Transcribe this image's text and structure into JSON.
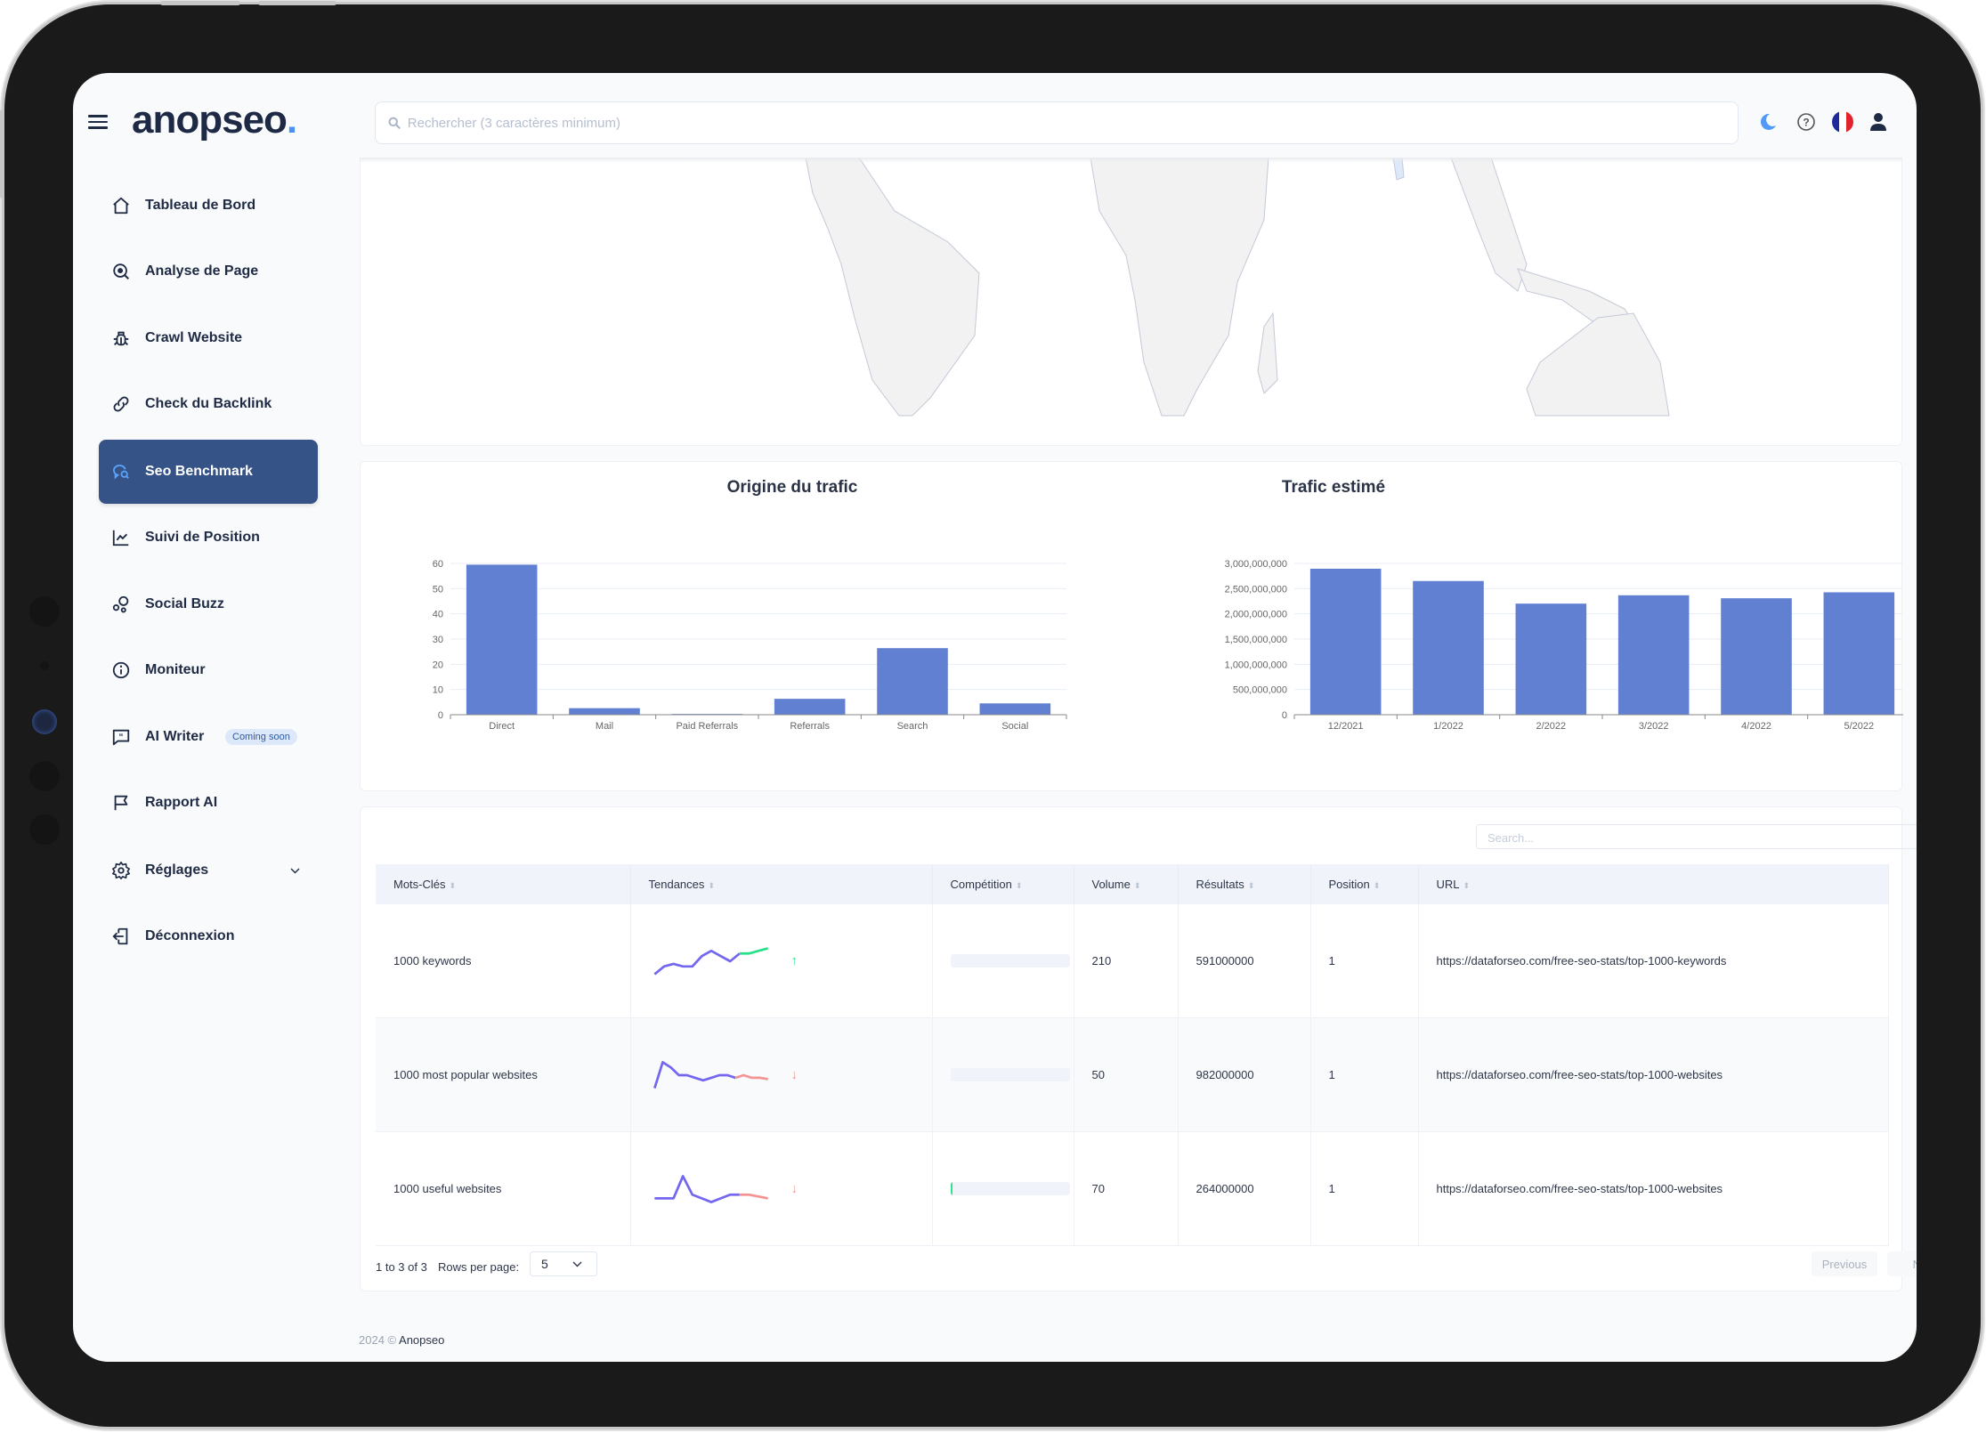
{
  "header": {
    "logo_text": "anopseo",
    "search_placeholder": "Rechercher (3 caractères minimum)",
    "icons": [
      "menu-icon",
      "moon-icon",
      "help-icon",
      "flag-fr-icon",
      "user-icon"
    ]
  },
  "sidebar": {
    "items": [
      {
        "label": "Tableau de Bord",
        "icon": "home-icon"
      },
      {
        "label": "Analyse de Page",
        "icon": "page-analysis-icon"
      },
      {
        "label": "Crawl Website",
        "icon": "bug-icon"
      },
      {
        "label": "Check du Backlink",
        "icon": "link-icon"
      },
      {
        "label": "Seo Benchmark",
        "icon": "benchmark-icon",
        "active": true
      },
      {
        "label": "Suivi de Position",
        "icon": "chart-line-icon"
      },
      {
        "label": "Social Buzz",
        "icon": "bubbles-icon"
      },
      {
        "label": "Moniteur",
        "icon": "info-icon"
      },
      {
        "label": "AI Writer",
        "icon": "quote-icon",
        "badge": "Coming soon"
      },
      {
        "label": "Rapport AI",
        "icon": "flag-icon"
      },
      {
        "label": "Réglages",
        "icon": "gear-icon",
        "has_submenu": true
      },
      {
        "label": "Déconnexion",
        "icon": "logout-icon"
      }
    ]
  },
  "colors": {
    "accent": "#365388",
    "bar": "#6280d2",
    "spark": "#7367f0",
    "up": "#28e08a",
    "down": "#f59393"
  },
  "chart_data": [
    {
      "type": "bar",
      "title": "Origine du trafic",
      "categories": [
        "Direct",
        "Mail",
        "Paid Referrals",
        "Referrals",
        "Search",
        "Social"
      ],
      "values": [
        59.5,
        2.6,
        0.3,
        6.3,
        26.4,
        4.5
      ],
      "yticks": [
        "0",
        "10",
        "20",
        "30",
        "40",
        "50",
        "60"
      ],
      "ylim": [
        0,
        60
      ],
      "xlabel": "",
      "ylabel": "",
      "grid": true,
      "legend": "none"
    },
    {
      "type": "bar",
      "title": "Trafic estimé",
      "categories": [
        "12/2021",
        "1/2022",
        "2/2022",
        "3/2022",
        "4/2022",
        "5/2022"
      ],
      "values": [
        2894000000,
        2651000000,
        2203000000,
        2368000000,
        2309000000,
        2427000000
      ],
      "yticks": [
        "0",
        "500,000,000",
        "1,000,000,000",
        "1,500,000,000",
        "2,000,000,000",
        "2,500,000,000",
        "3,000,000,000"
      ],
      "ylim": [
        0,
        3000000000
      ],
      "xlabel": "",
      "ylabel": "",
      "grid": true,
      "legend": "none"
    }
  ],
  "table": {
    "search_placeholder": "Search...",
    "columns": [
      "Mots-Clés",
      "Tendances",
      "Compétition",
      "Volume",
      "Résultats",
      "Position",
      "URL"
    ],
    "rows": [
      {
        "keyword": "1000 keywords",
        "trend": [
          2,
          5,
          6,
          5,
          5,
          9,
          11,
          9,
          7,
          10,
          10,
          11,
          12
        ],
        "trend_dir": "up",
        "competition": 0,
        "volume": "210",
        "results": "591000000",
        "position": "1",
        "url": "https://dataforseo.com/free-seo-stats/top-1000-keywords"
      },
      {
        "keyword": "1000 most popular websites",
        "trend": [
          2,
          12,
          10,
          7,
          7,
          6,
          5,
          6,
          7,
          7,
          6,
          7,
          6,
          6,
          5.5
        ],
        "trend_dir": "down",
        "competition": 0,
        "volume": "50",
        "results": "982000000",
        "position": "1",
        "url": "https://dataforseo.com/free-seo-stats/top-1000-websites"
      },
      {
        "keyword": "1000 useful websites",
        "trend": [
          5,
          5,
          5,
          11,
          6,
          5,
          4,
          5,
          6,
          6,
          6,
          5.5,
          5
        ],
        "trend_dir": "down",
        "competition": 2,
        "volume": "70",
        "results": "264000000",
        "position": "1",
        "url": "https://dataforseo.com/free-seo-stats/top-1000-websites"
      }
    ],
    "pagination": {
      "range": "1 to 3 of 3",
      "rows_per_page_label": "Rows per page:",
      "rows_per_page": "5",
      "previous": "Previous",
      "next": "Next"
    }
  },
  "footer": {
    "year": "2024 ©",
    "brand": "Anopseo"
  }
}
